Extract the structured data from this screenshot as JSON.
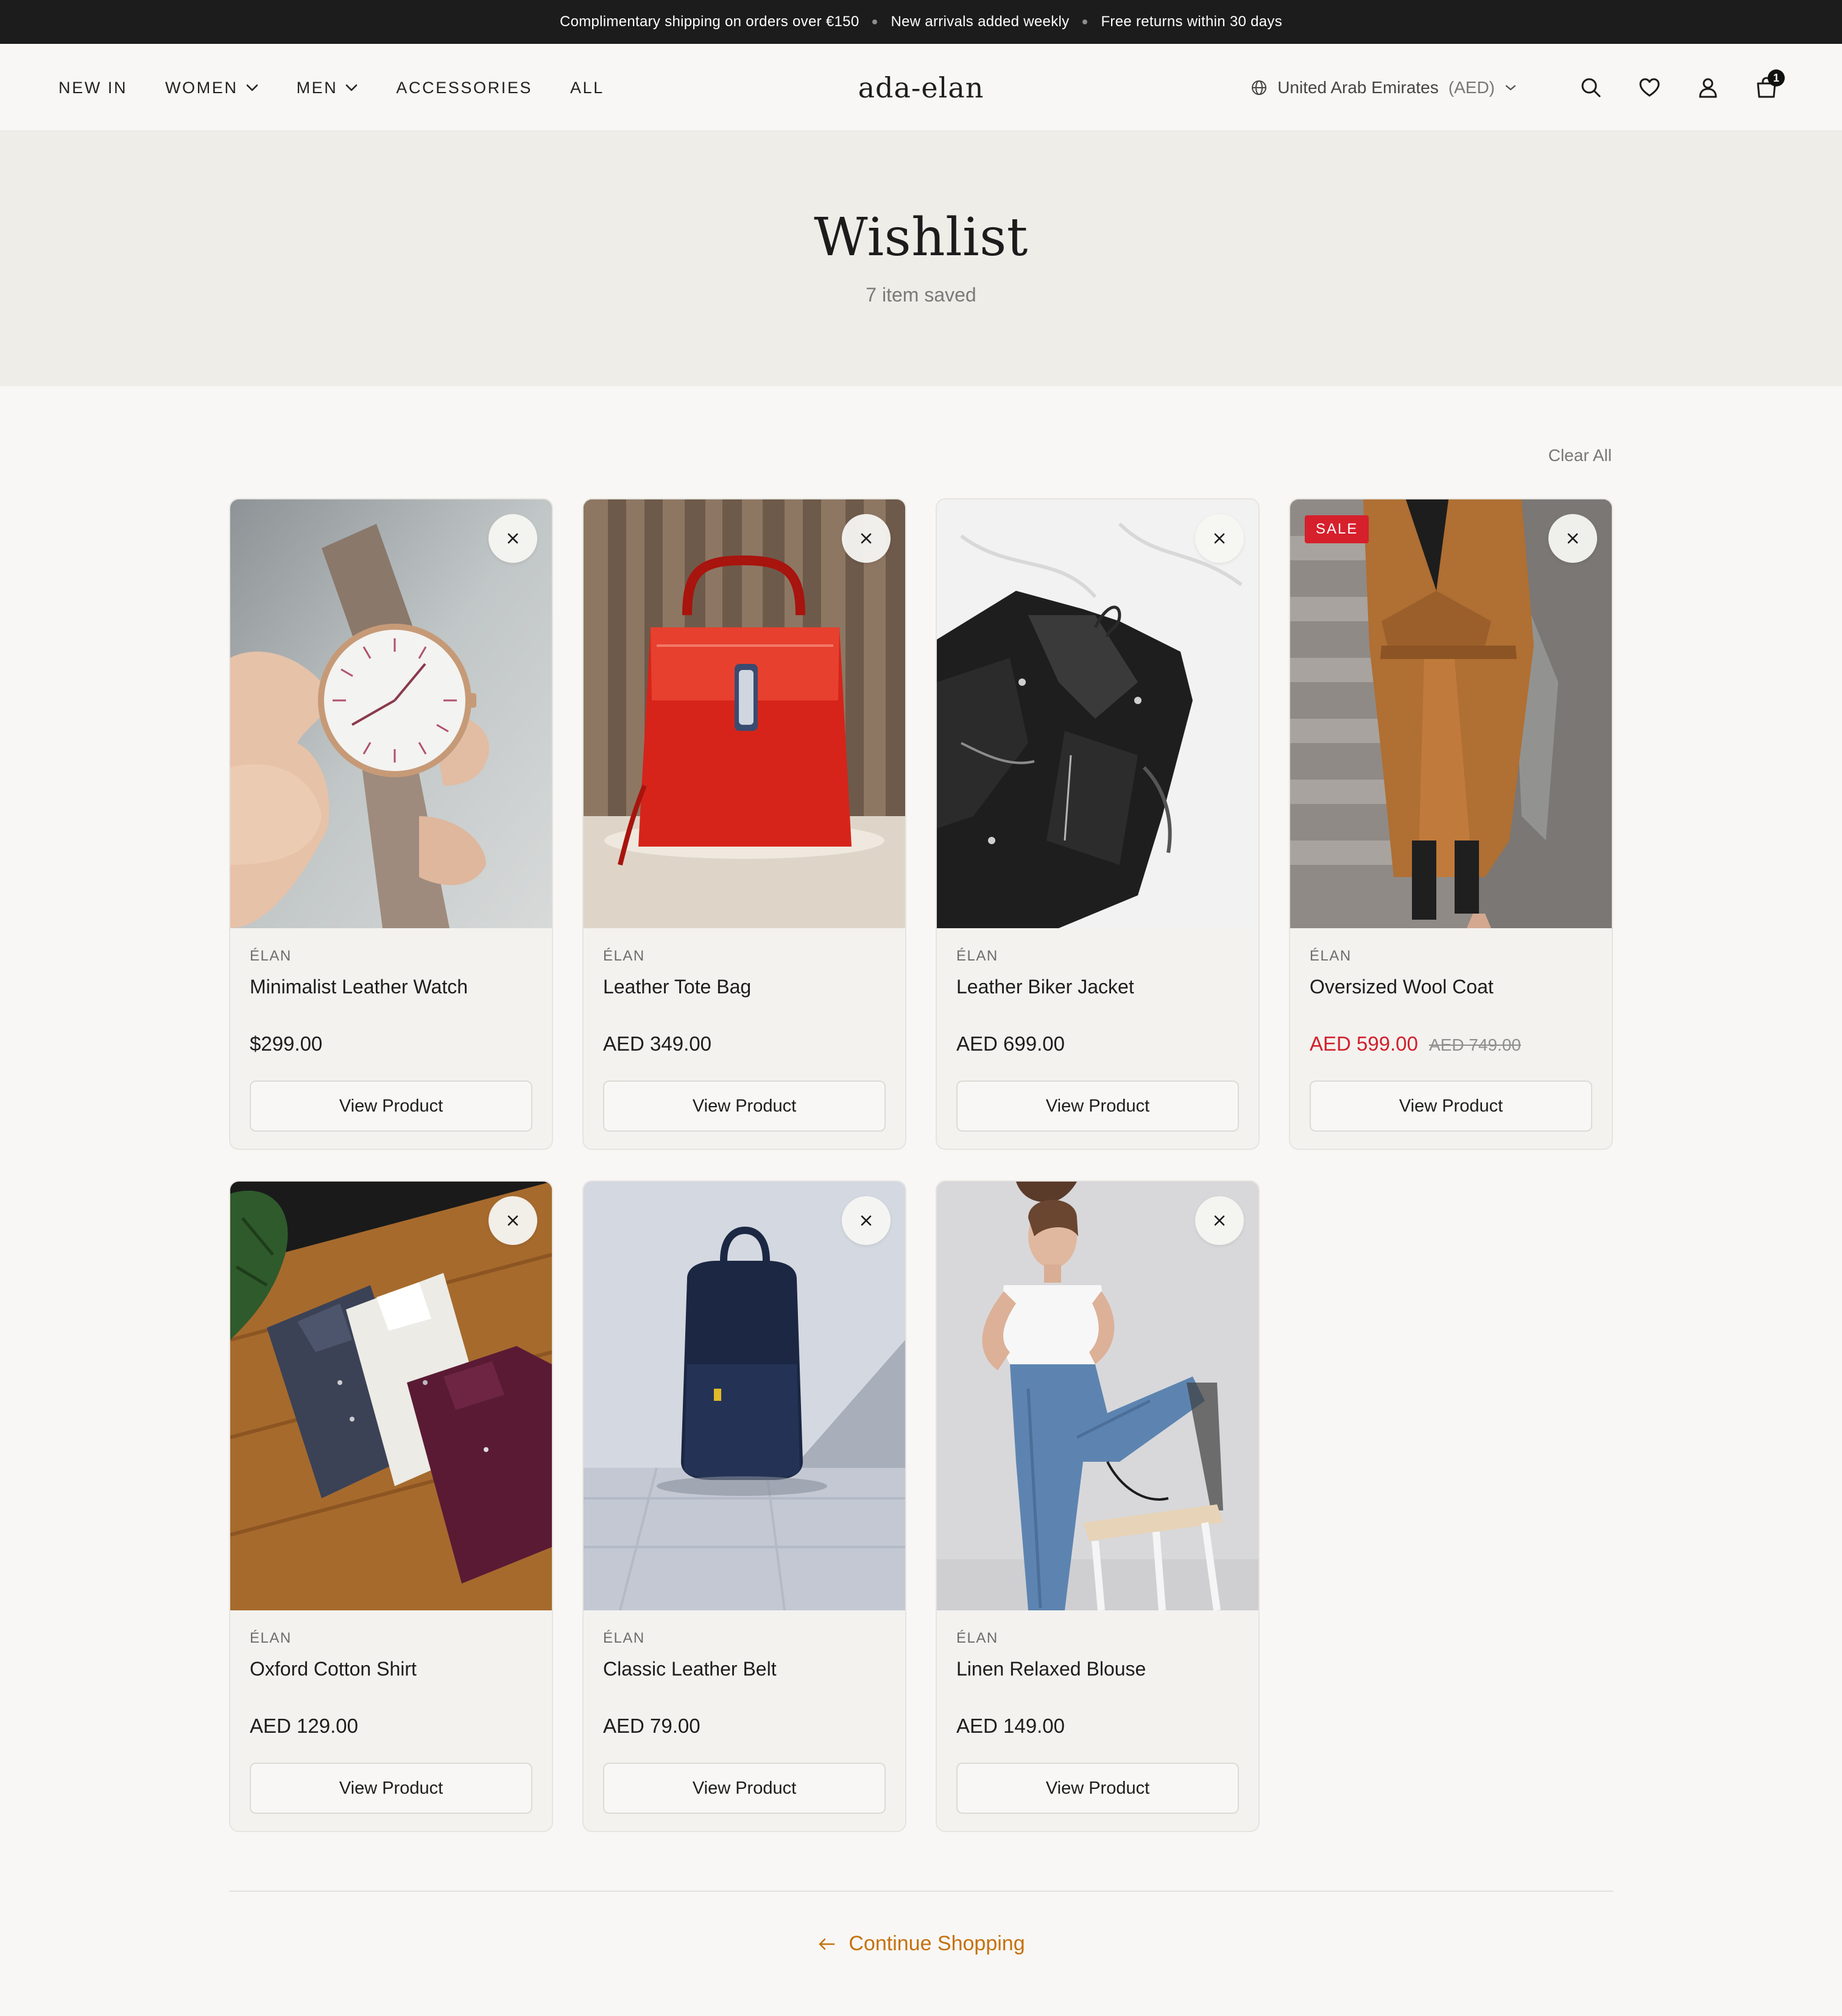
{
  "announcement": {
    "items": [
      "Complimentary shipping on orders over €150",
      "New arrivals added weekly",
      "Free returns within 30 days"
    ]
  },
  "header": {
    "nav": [
      {
        "label": "NEW IN",
        "has_dropdown": false
      },
      {
        "label": "WOMEN",
        "has_dropdown": true
      },
      {
        "label": "MEN",
        "has_dropdown": true
      },
      {
        "label": "ACCESSORIES",
        "has_dropdown": false
      },
      {
        "label": "ALL",
        "has_dropdown": false
      }
    ],
    "logo": "ada-elan",
    "region": {
      "country": "United Arab Emirates",
      "currency": "(AED)"
    },
    "icons": [
      "search-icon",
      "heart-icon",
      "user-icon",
      "bag-icon"
    ],
    "cart_count": "1"
  },
  "hero": {
    "title": "Wishlist",
    "count_label": "7 item saved"
  },
  "actions": {
    "clear_all": "Clear All",
    "continue_shopping": "Continue Shopping"
  },
  "colors": {
    "accent": "#c5710d",
    "sale": "#d21f2b",
    "hero_bg": "#efede8",
    "announcement_bg": "#1c1c1c"
  },
  "products": [
    {
      "brand": "ÉLAN",
      "name": "Minimalist Leather Watch",
      "price": "$299.00",
      "old_price": "",
      "sale": false,
      "button": "View Product",
      "image": "watch-photo"
    },
    {
      "brand": "ÉLAN",
      "name": "Leather Tote Bag",
      "price": "AED 349.00",
      "old_price": "",
      "sale": false,
      "button": "View Product",
      "image": "red-handbag-photo"
    },
    {
      "brand": "ÉLAN",
      "name": "Leather Biker Jacket",
      "price": "AED 699.00",
      "old_price": "",
      "sale": false,
      "button": "View Product",
      "image": "black-leather-jacket-photo"
    },
    {
      "brand": "ÉLAN",
      "name": "Oversized Wool Coat",
      "price": "AED 599.00",
      "old_price": "AED 749.00",
      "sale": true,
      "sale_label": "SALE",
      "button": "View Product",
      "image": "camel-coat-photo"
    },
    {
      "brand": "ÉLAN",
      "name": "Oxford Cotton Shirt",
      "price": "AED 129.00",
      "old_price": "",
      "sale": false,
      "button": "View Product",
      "image": "folded-shirts-photo"
    },
    {
      "brand": "ÉLAN",
      "name": "Classic Leather Belt",
      "price": "AED 79.00",
      "old_price": "",
      "sale": false,
      "button": "View Product",
      "image": "navy-backpack-photo"
    },
    {
      "brand": "ÉLAN",
      "name": "Linen Relaxed Blouse",
      "price": "AED 149.00",
      "old_price": "",
      "sale": false,
      "button": "View Product",
      "image": "woman-jeans-photo"
    }
  ]
}
